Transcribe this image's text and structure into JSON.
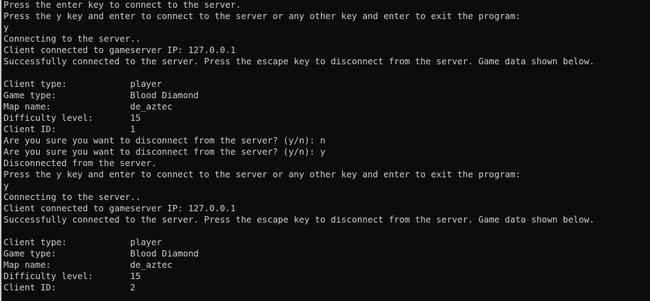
{
  "console": {
    "lines": [
      "Press the enter key to connect to the server.",
      "Press the y key and enter to connect to the server or any other key and enter to exit the program:",
      "y",
      "Connecting to the server..",
      "Client connected to gameserver IP: 127.0.0.1",
      "Successfully connected to the server. Press the escape key to disconnect from the server. Game data shown below.",
      "",
      "Client type:            player",
      "Game type:              Blood Diamond",
      "Map name:               de_aztec",
      "Difficulty level:       15",
      "Client ID:              1",
      "Are you sure you want to disconnect from the server? (y/n): n",
      "Are you sure you want to disconnect from the server? (y/n): y",
      "Disconnected from the server.",
      "Press the y key and enter to connect to the server or any other key and enter to exit the program:",
      "y",
      "Connecting to the server..",
      "Client connected to gameserver IP: 127.0.0.1",
      "Successfully connected to the server. Press the escape key to disconnect from the server. Game data shown below.",
      "",
      "Client type:            player",
      "Game type:              Blood Diamond",
      "Map name:               de_aztec",
      "Difficulty level:       15",
      "Client ID:              2"
    ]
  },
  "colors": {
    "background": "#0c0c0c",
    "text": "#cccccc"
  }
}
